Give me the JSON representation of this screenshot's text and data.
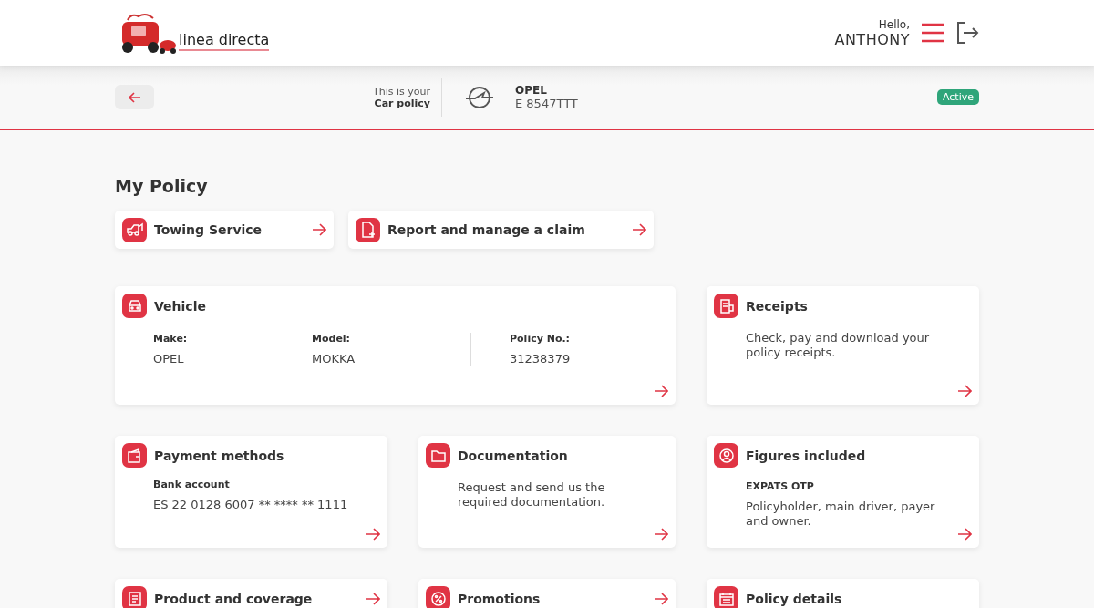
{
  "header": {
    "logo_text": "linea directa",
    "greeting": "Hello,",
    "user_name": "ANTHONY"
  },
  "policy_bar": {
    "intro": "This is your",
    "policy_type": "Car policy",
    "make": "OPEL",
    "plate": "E 8547TTT",
    "status": "Active"
  },
  "section_title": "My Policy",
  "quick_actions": [
    {
      "label": "Towing Service"
    },
    {
      "label": "Report and manage a claim"
    }
  ],
  "cards": [
    {
      "kind": "wide",
      "title": "Vehicle",
      "fields": [
        {
          "label": "Make:",
          "value": "OPEL"
        },
        {
          "label": "Model:",
          "value": "MOKKA"
        },
        {
          "label": "Policy No.:",
          "value": "31238379"
        }
      ]
    },
    {
      "kind": "text",
      "title": "Receipts",
      "description": "Check, pay and download your policy receipts."
    },
    {
      "kind": "account",
      "title": "Payment methods",
      "fields": [
        {
          "label": "Bank account",
          "value": "ES 22 0128 6007 ** **** ** 1111"
        }
      ]
    },
    {
      "kind": "text",
      "title": "Documentation",
      "description": "Request and send us the required documentation."
    },
    {
      "kind": "subtitled",
      "title": "Figures included",
      "subtitle": "EXPATS OTP",
      "description": "Policyholder, main driver, payer and owner."
    },
    {
      "kind": "compact",
      "title": "Product and coverage"
    },
    {
      "kind": "compact",
      "title": "Promotions"
    },
    {
      "kind": "plain",
      "title": "Policy details"
    }
  ]
}
